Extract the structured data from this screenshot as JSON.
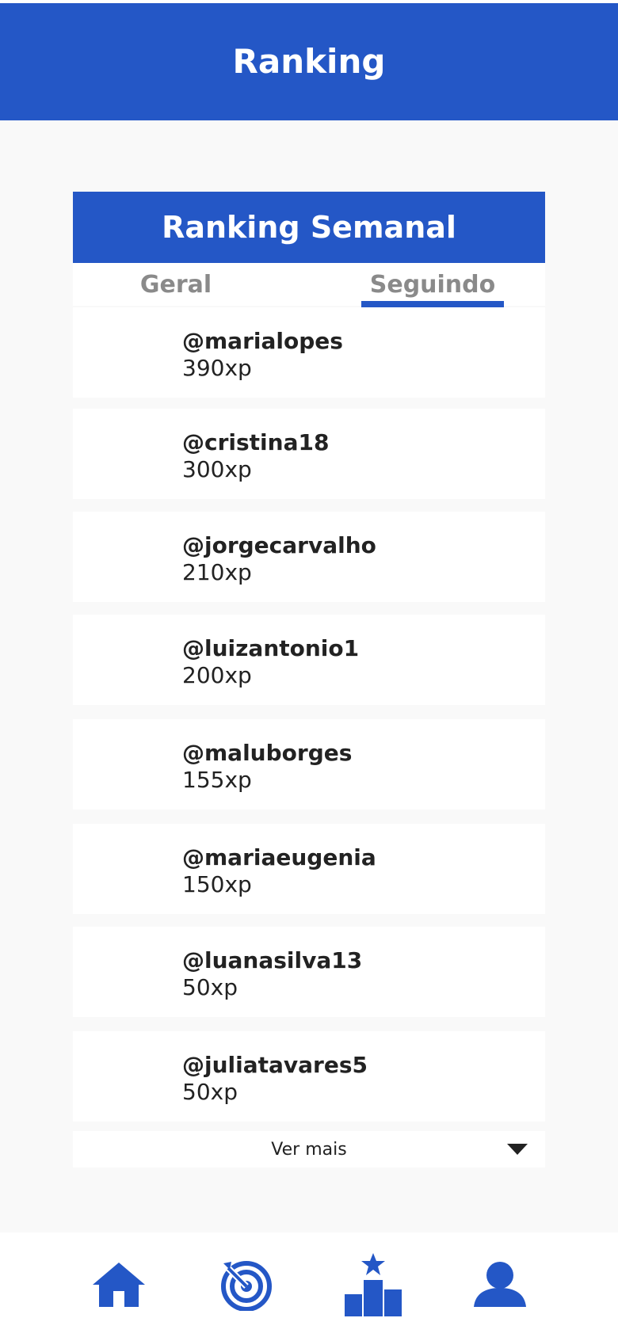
{
  "header": {
    "title": "Ranking"
  },
  "ranking_card": {
    "title": "Ranking Semanal",
    "tabs": [
      {
        "label": "Geral",
        "active": false
      },
      {
        "label": "Seguindo",
        "active": true
      }
    ],
    "entries": [
      {
        "username": "@marialopes",
        "xp": "390xp"
      },
      {
        "username": "@cristina18",
        "xp": "300xp"
      },
      {
        "username": "@jorgecarvalho",
        "xp": "210xp"
      },
      {
        "username": "@luizantonio1",
        "xp": "200xp"
      },
      {
        "username": "@maluborges",
        "xp": "155xp"
      },
      {
        "username": "@mariaeugenia",
        "xp": "150xp"
      },
      {
        "username": "@luanasilva13",
        "xp": "50xp"
      },
      {
        "username": "@juliatavares5",
        "xp": "50xp"
      }
    ],
    "see_more_label": "Ver mais",
    "see_more_icon": "caret-down-icon"
  },
  "bottom_nav": {
    "items": [
      {
        "icon": "home-icon",
        "active": false
      },
      {
        "icon": "target-icon",
        "active": false
      },
      {
        "icon": "podium-star-icon",
        "active": true
      },
      {
        "icon": "user-icon",
        "active": false
      }
    ]
  },
  "colors": {
    "accent": "#2457c6",
    "background": "#f9f9f9",
    "card": "#ffffff",
    "text": "#222222",
    "tab_text": "#8a8a8a"
  }
}
